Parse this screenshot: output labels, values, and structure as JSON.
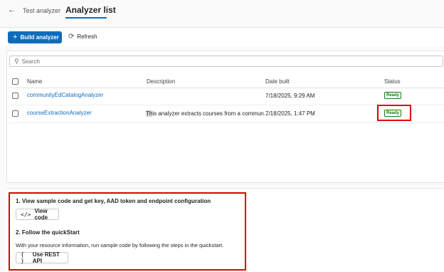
{
  "nav": {
    "back_icon": "←",
    "tab_test": "Test analyzer",
    "tab_list": "Analyzer list"
  },
  "toolbar": {
    "build_label": "Build analyzer",
    "refresh_label": "Refresh",
    "refresh_icon": "⟳"
  },
  "search": {
    "placeholder": "Search",
    "icon": "⚲"
  },
  "table": {
    "headers": [
      "Name",
      "Description",
      "Date built",
      "Status"
    ],
    "rows": [
      {
        "name": "communityEdCatalogAnalyzer",
        "description": "",
        "date": "7/18/2025, 9:29 AM",
        "status": "Ready"
      },
      {
        "name": "courseExtractionAnalyzer",
        "description_cursor": "Th",
        "description": "is analyzer extracts courses from a commun...",
        "date": "7/18/2025, 1:47 PM",
        "status": "Ready"
      }
    ]
  },
  "steps": {
    "step1_title": "1. View sample code and get key, AAD token and endpoint configuration",
    "view_code_icon": "</>",
    "view_code_label": "View code",
    "step2_title": "2. Follow the quickStart",
    "step2_text": "With your resource information, run sample code by following the steps in the quickstart.",
    "rest_icon": "{ }",
    "rest_label": "Use REST API"
  },
  "colors": {
    "accent": "#0f6cbd",
    "ready": "#107c10",
    "highlight": "#e00000"
  }
}
